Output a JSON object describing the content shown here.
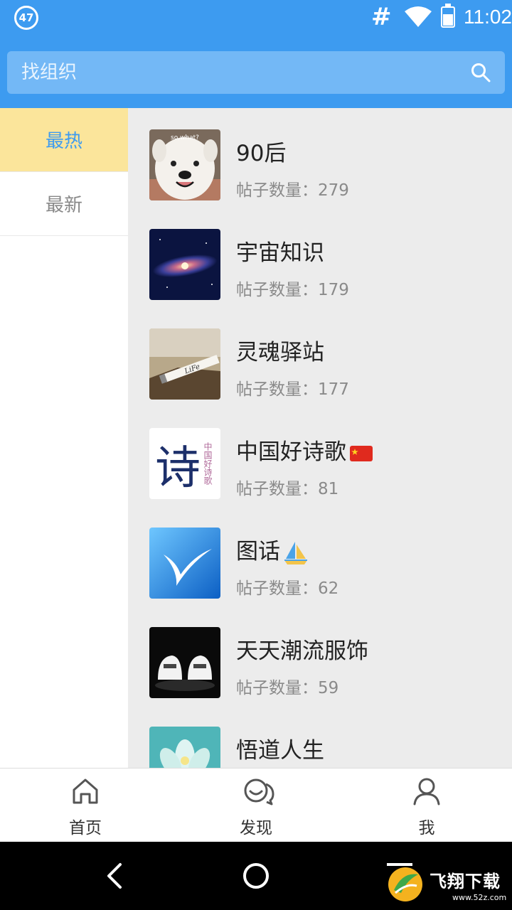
{
  "status_bar": {
    "notification_badge": "47",
    "hash_symbol": "#",
    "time": "11:02",
    "icons": [
      "wifi-icon",
      "battery-icon"
    ]
  },
  "search": {
    "placeholder": "找组织",
    "icon": "search-icon"
  },
  "sidebar": {
    "items": [
      {
        "label": "最热",
        "active": true
      },
      {
        "label": "最新",
        "active": false
      }
    ]
  },
  "groups": [
    {
      "title": "90后",
      "count_label": "帖子数量：279"
    },
    {
      "title": "宇宙知识",
      "count_label": "帖子数量：179"
    },
    {
      "title": "灵魂驿站",
      "count_label": "帖子数量：177"
    },
    {
      "title": "中国好诗歌",
      "count_label": "帖子数量：81"
    },
    {
      "title": "图话",
      "count_label": "帖子数量：62"
    },
    {
      "title": "天天潮流服饰",
      "count_label": "帖子数量：59"
    },
    {
      "title": "悟道人生",
      "count_label": ""
    }
  ],
  "thumb_text": {
    "dog": "so,what?",
    "life": "LiFe",
    "poem": "诗",
    "poem_side": "中国好诗歌"
  },
  "tabs": [
    {
      "label": "首页",
      "icon": "home-icon"
    },
    {
      "label": "发现",
      "icon": "discover-chat-icon"
    },
    {
      "label": "我",
      "icon": "profile-icon"
    }
  ],
  "watermark": {
    "text": "飞翔下载",
    "sub": "www.52z.com"
  },
  "colors": {
    "primary": "#3d9bf0",
    "active_nav_bg": "#fbe59b"
  }
}
